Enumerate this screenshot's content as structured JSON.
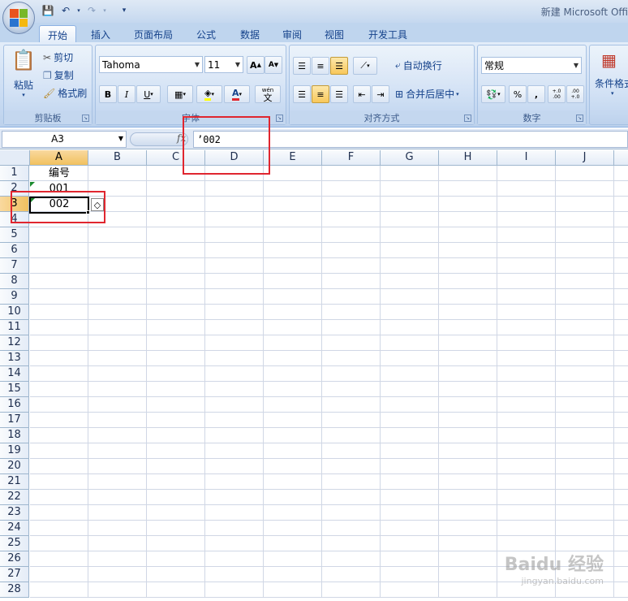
{
  "window": {
    "title": "新建 Microsoft Offi"
  },
  "qat": {
    "save_icon": "save-icon",
    "undo_icon": "undo-icon",
    "redo_icon": "redo-icon",
    "customize_icon": "customize-qat-icon"
  },
  "tabs": [
    "开始",
    "插入",
    "页面布局",
    "公式",
    "数据",
    "审阅",
    "视图",
    "开发工具"
  ],
  "active_tab": "开始",
  "ribbon": {
    "clipboard": {
      "label": "剪贴板",
      "paste": "粘贴",
      "cut": "剪切",
      "copy": "复制",
      "format_painter": "格式刷"
    },
    "font": {
      "label": "字体",
      "font_name": "Tahoma",
      "font_size": "11",
      "bold": "B",
      "italic": "I",
      "underline": "U",
      "grow": "A",
      "shrink": "A",
      "font_color": "A",
      "wen": "wén",
      "wen_char": "文"
    },
    "alignment": {
      "label": "对齐方式",
      "wrap_text": "自动换行",
      "merge_center": "合并后居中"
    },
    "number": {
      "label": "数字",
      "format": "常规",
      "percent": "%",
      "comma": ",",
      "inc_decimal": "+.0 .00",
      "dec_decimal": ".00 +.0"
    },
    "styles": {
      "conditional_format": "条件格式"
    }
  },
  "formula_bar": {
    "name_box": "A3",
    "fx": "fx",
    "value": "’002"
  },
  "columns": [
    "A",
    "B",
    "C",
    "D",
    "E",
    "F",
    "G",
    "H",
    "I",
    "J"
  ],
  "rows": [
    "1",
    "2",
    "3",
    "4",
    "5",
    "6",
    "7",
    "8",
    "9",
    "10",
    "11",
    "12",
    "13",
    "14",
    "15",
    "16",
    "17",
    "18",
    "19",
    "20",
    "21",
    "22",
    "23",
    "24",
    "25",
    "26",
    "27",
    "28"
  ],
  "cells": {
    "A1": "编号",
    "A2": "001",
    "A3": "002"
  },
  "selection": {
    "active_cell": "A3",
    "active_column": "A",
    "active_row": "3"
  },
  "watermark": {
    "text": "Baidu 经验",
    "sub": "jingyan.baidu.com"
  },
  "colors": {
    "ribbon": "#c7daf2",
    "selected_header": "#f1c15f",
    "annotation_red": "#e0262f",
    "error_triangle": "#1b8a2e"
  }
}
